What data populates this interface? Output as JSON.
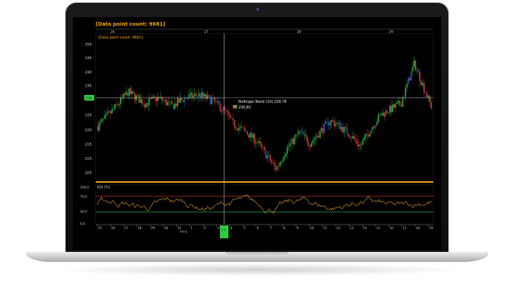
{
  "window": {
    "header_label": "[Data point count: 9681]",
    "inner_label": "[Data point count: 9681]"
  },
  "colors": {
    "background": "#000000",
    "up": "#2fb344",
    "down": "#d8413a",
    "neutral": "#2d4fb8",
    "crosshair": "#dddddd",
    "accent": "#f5a623",
    "rsi_line": "#f5a623",
    "rsi_high": "#c0392b",
    "rsi_low": "#27ae60",
    "marker": "#2ecc40"
  },
  "top_axis": {
    "labels": [
      "26",
      "27",
      "28",
      "29"
    ]
  },
  "price_axis": {
    "labels": [
      "250",
      "245",
      "240",
      "235",
      "230",
      "225",
      "220",
      "215",
      "210",
      "205"
    ],
    "marker_value": "230"
  },
  "tooltip": {
    "line1": "Bollinger Band (10) 229,76",
    "line2": "230,82"
  },
  "rsi_panel": {
    "title": "RSI (%)",
    "labels": [
      "100,0",
      "70,0",
      "30,0",
      "0,0"
    ]
  },
  "bottom_axis": {
    "labels": [
      "25",
      "26",
      "27",
      "28",
      "29",
      "30",
      "31",
      "1",
      "2",
      "3",
      "4",
      "5",
      "6",
      "7",
      "8",
      "9",
      "10",
      "11",
      "12",
      "13",
      "14",
      "15",
      "16",
      "17",
      "18",
      "19"
    ],
    "sub_label": "Irena",
    "marker_value": "2 5"
  },
  "chart_data": {
    "type": "candlestick",
    "title": "[Data point count: 9681]",
    "ylim": [
      203,
      253
    ],
    "price_path": [
      [
        0,
        221
      ],
      [
        4,
        226
      ],
      [
        9,
        233
      ],
      [
        14,
        229
      ],
      [
        18,
        231
      ],
      [
        22,
        228
      ],
      [
        26,
        231
      ],
      [
        30,
        232
      ],
      [
        34,
        230
      ],
      [
        38,
        226
      ],
      [
        40,
        222
      ],
      [
        44,
        219
      ],
      [
        47,
        216
      ],
      [
        50,
        211
      ],
      [
        53,
        206
      ],
      [
        56,
        213
      ],
      [
        60,
        219
      ],
      [
        63,
        215
      ],
      [
        66,
        219
      ],
      [
        69,
        223
      ],
      [
        72,
        221
      ],
      [
        75,
        218
      ],
      [
        78,
        214
      ],
      [
        81,
        220
      ],
      [
        84,
        225
      ],
      [
        87,
        227
      ],
      [
        90,
        229
      ],
      [
        92,
        236
      ],
      [
        94,
        243
      ],
      [
        96,
        237
      ],
      [
        99,
        228
      ]
    ],
    "bollinger_band_10": 229.76,
    "tooltip_value": 230.82,
    "rsi": {
      "ylim": [
        0,
        100
      ],
      "upper_level": 70,
      "lower_level": 30
    }
  }
}
